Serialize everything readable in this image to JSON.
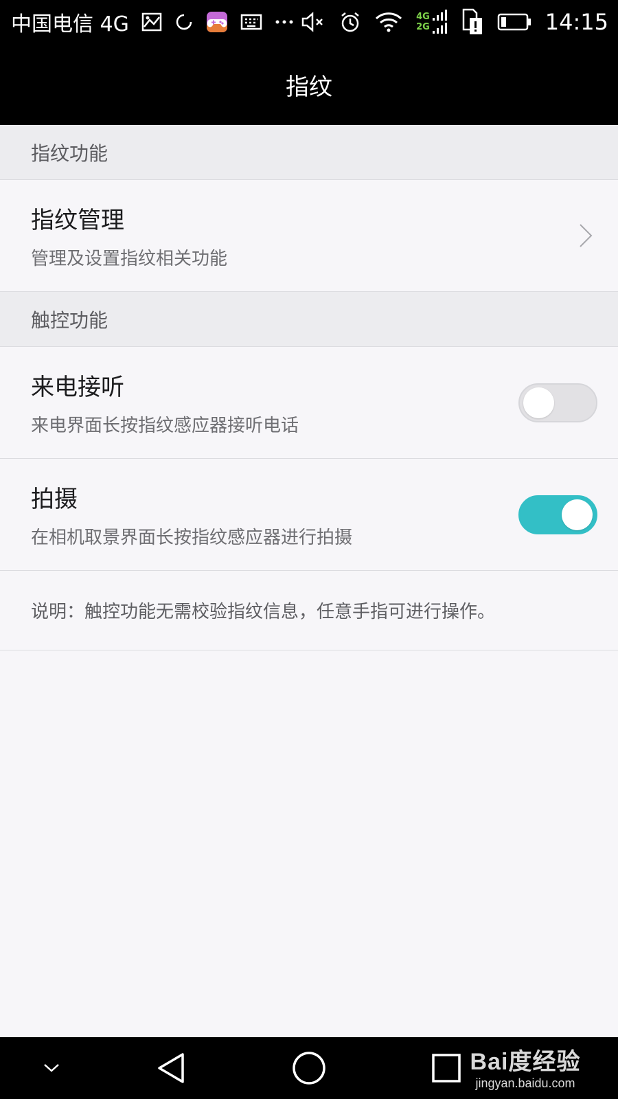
{
  "status_bar": {
    "carrier": "中国电信 4G",
    "network_label_top": "4G",
    "network_label_bottom": "2G",
    "time": "14:15",
    "icons": [
      "image-icon",
      "sync-icon",
      "game-icon",
      "keyboard-icon",
      "more-icon",
      "mute-icon",
      "alarm-icon",
      "wifi-icon",
      "signal-icon",
      "sim-icon",
      "battery-icon"
    ]
  },
  "header": {
    "title": "指纹"
  },
  "sections": [
    {
      "header": "指纹功能",
      "items": [
        {
          "title": "指纹管理",
          "subtitle": "管理及设置指纹相关功能",
          "control": "chevron"
        }
      ]
    },
    {
      "header": "触控功能",
      "items": [
        {
          "title": "来电接听",
          "subtitle": "来电界面长按指纹感应器接听电话",
          "control": "toggle",
          "enabled": false
        },
        {
          "title": "拍摄",
          "subtitle": "在相机取景界面长按指纹感应器进行拍摄",
          "control": "toggle",
          "enabled": true
        }
      ]
    }
  ],
  "note": "说明：触控功能无需校验指纹信息，任意手指可进行操作。",
  "nav_bar": {
    "icons": [
      "chevron-down-icon",
      "back-icon",
      "home-icon",
      "recents-icon"
    ]
  },
  "watermark": {
    "logo": "Bai度经验",
    "url": "jingyan.baidu.com"
  },
  "colors": {
    "accent": "#33bfc6",
    "background": "#f7f6f9",
    "section_header": "#ececef",
    "bar": "#000000"
  }
}
